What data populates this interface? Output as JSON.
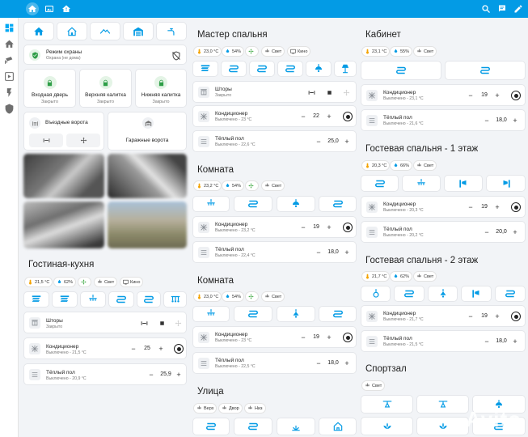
{
  "colors": {
    "accent": "#03a9f4",
    "topbar": "#039be5",
    "secure": "#2e9e47"
  },
  "topbar": {
    "icons": [
      "home-icon",
      "picture-icon",
      "house-alert-icon"
    ],
    "right_icons": [
      "search-icon",
      "chat-icon",
      "pencil-icon"
    ]
  },
  "sidebar": {
    "icons": [
      "dashboard-icon",
      "home-icon",
      "cctv-icon",
      "video-icon",
      "lightning-icon",
      "shield-icon"
    ]
  },
  "left": {
    "scene_icons": [
      "home-icon",
      "home-outline-icon",
      "roof-icon",
      "garage-icon",
      "tap-icon"
    ],
    "security": {
      "title": "Режим охраны",
      "status": "Охрана (не дома)"
    },
    "locks": [
      {
        "title": "Входная дверь",
        "status": "Закрыто"
      },
      {
        "title": "Верхняя калитка",
        "status": "Закрыто"
      },
      {
        "title": "Нижняя калитка",
        "status": "Закрыто"
      }
    ],
    "gates": {
      "entry": "Въездные ворота",
      "garage": "Гаражные ворота"
    },
    "living_title": "Гостиная-кухня",
    "living_chips": [
      "21,5 °C",
      "62%",
      "",
      "Свет",
      "Кино"
    ],
    "blinds": {
      "title": "Шторы",
      "status": "Закрыто"
    },
    "ac": {
      "title": "Кондиционер",
      "status": "Выключено - 21,5 °C",
      "value": "25"
    },
    "floor": {
      "title": "Тёплый пол",
      "status": "Выключено - 20,9 °C",
      "value": "25,9"
    }
  },
  "middle": {
    "bedroom_title": "Мастер спальня",
    "bedroom_chips": [
      "23,0 °C",
      "54%",
      "",
      "Свет",
      "Кино"
    ],
    "bedroom_blinds": {
      "title": "Шторы",
      "status": "Закрыто"
    },
    "bedroom_ac": {
      "title": "Кондиционер",
      "status": "Выключено - 23 °C",
      "value": "22"
    },
    "bedroom_floor": {
      "title": "Тёплый пол",
      "status": "Выключено - 22,6 °C",
      "value": "25,0"
    },
    "room1_title": "Комната",
    "room1_chips": [
      "23,2 °C",
      "54%",
      "",
      "Свет"
    ],
    "room1_ac": {
      "title": "Кондиционер",
      "status": "Выключено - 23,2 °C",
      "value": "19"
    },
    "room1_floor": {
      "title": "Тёплый пол",
      "status": "Выключено - 22,4 °C",
      "value": "18,0"
    },
    "room2_title": "Комната",
    "room2_chips": [
      "23,0 °C",
      "54%",
      "",
      "Свет"
    ],
    "room2_ac": {
      "title": "Кондиционер",
      "status": "Выключено - 23 °C",
      "value": "19"
    },
    "room2_floor": {
      "title": "Тёплый пол",
      "status": "Выключено - 22,5 °C",
      "value": "18,0"
    },
    "street_title": "Улица",
    "street_chips": [
      "Верх",
      "Двор",
      "Низ"
    ]
  },
  "right": {
    "office_title": "Кабинет",
    "office_chips": [
      "23,1 °C",
      "55%",
      "Свет"
    ],
    "office_ac": {
      "title": "Кондиционер",
      "status": "Выключено - 23,1 °C",
      "value": "19"
    },
    "office_floor": {
      "title": "Тёплый пол",
      "status": "Выключено - 21,6 °C",
      "value": "18,0"
    },
    "guest1_title": "Гостевая спальня - 1 этаж",
    "guest1_chips": [
      "20,3 °C",
      "66%",
      "Свет"
    ],
    "guest1_ac": {
      "title": "Кондиционер",
      "status": "Выключено - 20,3 °C",
      "value": "19"
    },
    "guest1_floor": {
      "title": "Тёплый пол",
      "status": "Выключено - 20,2 °C",
      "value": "20,0"
    },
    "guest2_title": "Гостевая спальня - 2 этаж",
    "guest2_chips": [
      "21,7 °C",
      "62%",
      "Свет"
    ],
    "guest2_ac": {
      "title": "Кондиционер",
      "status": "Выключено - 21,7 °C",
      "value": "19"
    },
    "guest2_floor": {
      "title": "Тёплый пол",
      "status": "Выключено - 21,5 °C",
      "value": "18,0"
    },
    "gym_title": "Спортзал",
    "gym_chips": [
      "Свет"
    ],
    "watermark": "Avito"
  }
}
